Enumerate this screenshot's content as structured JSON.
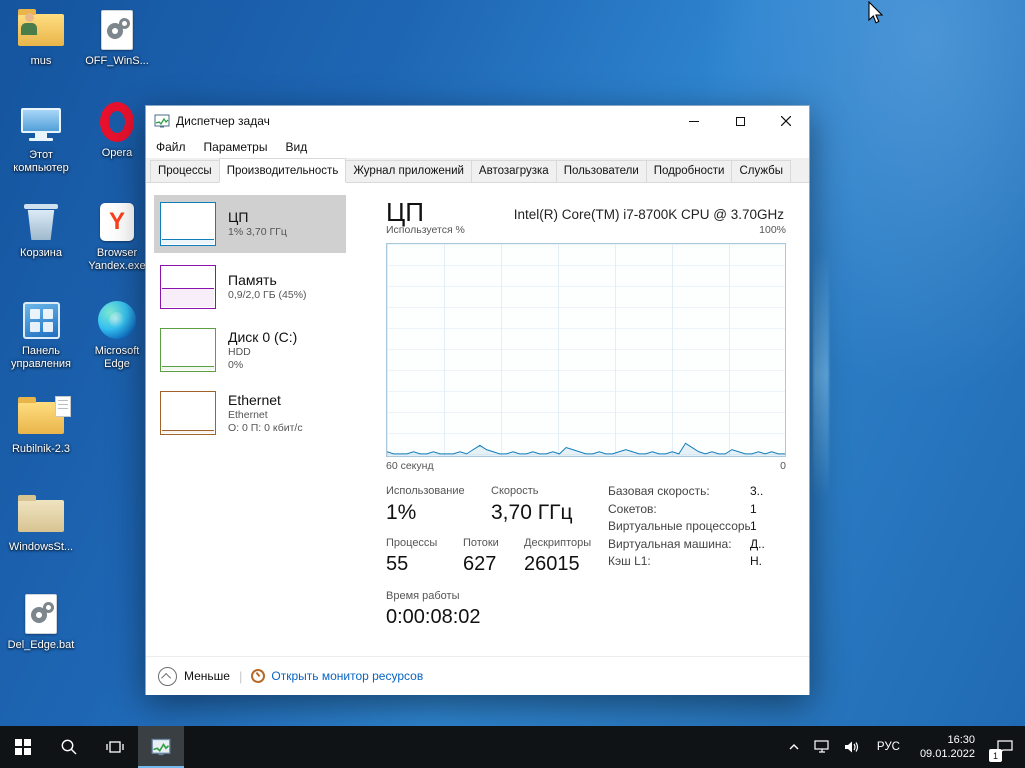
{
  "desktop": {
    "icons": [
      {
        "label": "mus"
      },
      {
        "label": "Этот компьютер"
      },
      {
        "label": "Корзина"
      },
      {
        "label": "Панель управления"
      },
      {
        "label": "Rubilnik-2.3"
      },
      {
        "label": "WindowsSt..."
      },
      {
        "label": "Del_Edge.bat"
      },
      {
        "label": "OFF_WinS..."
      },
      {
        "label": "Opera"
      },
      {
        "label": "Browser Yandex.exe"
      },
      {
        "label": "Microsoft Edge"
      }
    ],
    "yandex_letter": "Y"
  },
  "taskman": {
    "title": "Диспетчер задач",
    "menu": [
      "Файл",
      "Параметры",
      "Вид"
    ],
    "tabs": [
      "Процессы",
      "Производительность",
      "Журнал приложений",
      "Автозагрузка",
      "Пользователи",
      "Подробности",
      "Службы"
    ],
    "sidebar": [
      {
        "title": "ЦП",
        "line1": "1% 3,70 ГГц",
        "line2": ""
      },
      {
        "title": "Память",
        "line1": "0,9/2,0 ГБ (45%)",
        "line2": ""
      },
      {
        "title": "Диск 0 (C:)",
        "line1": "HDD",
        "line2": "0%"
      },
      {
        "title": "Ethernet",
        "line1": "Ethernet",
        "line2": "О: 0 П: 0 кбит/с"
      }
    ],
    "main": {
      "device_title": "ЦП",
      "device_name": "Intel(R) Core(TM) i7-8700K CPU @ 3.70GHz",
      "y_axis_label": "Используется %",
      "y_max_label": "100%",
      "x_left_label": "60 секунд",
      "x_right_label": "0",
      "usage_label": "Использование",
      "usage_value": "1%",
      "speed_label": "Скорость",
      "speed_value": "3,70 ГГц",
      "processes_label": "Процессы",
      "processes_value": "55",
      "threads_label": "Потоки",
      "threads_value": "627",
      "handles_label": "Дескрипторы",
      "handles_value": "26015",
      "uptime_label": "Время работы",
      "uptime_value": "0:00:08:02",
      "details": [
        {
          "label": "Базовая скорость:",
          "value": "3.."
        },
        {
          "label": "Сокетов:",
          "value": "1"
        },
        {
          "label": "Виртуальные процессоры:",
          "value": "1"
        },
        {
          "label": "Виртуальная машина:",
          "value": "Д.."
        },
        {
          "label": "Кэш L1:",
          "value": "Н."
        }
      ]
    },
    "footer": {
      "less": "Меньше",
      "divider": "|",
      "resmon": "Открыть монитор ресурсов"
    }
  },
  "taskbar": {
    "lang": "РУС",
    "time": "16:30",
    "date": "09.01.2022",
    "notification_count": "1"
  },
  "chart_data": {
    "type": "area",
    "title": "ЦП — Используется %",
    "ylabel": "Используется %",
    "ylim": [
      0,
      100
    ],
    "x_window_label": "60 секунд",
    "legend": "off",
    "grid": "on",
    "values": [
      2,
      1,
      1,
      1,
      2,
      1,
      1,
      2,
      1,
      1,
      1,
      2,
      1,
      3,
      5,
      3,
      2,
      1,
      1,
      2,
      1,
      1,
      2,
      1,
      1,
      2,
      1,
      4,
      3,
      2,
      1,
      1,
      2,
      1,
      1,
      2,
      3,
      2,
      1,
      1,
      2,
      1,
      1,
      2,
      1,
      6,
      4,
      2,
      1,
      2,
      1,
      1,
      3,
      2,
      1,
      1,
      2,
      1,
      2,
      1,
      1
    ]
  }
}
